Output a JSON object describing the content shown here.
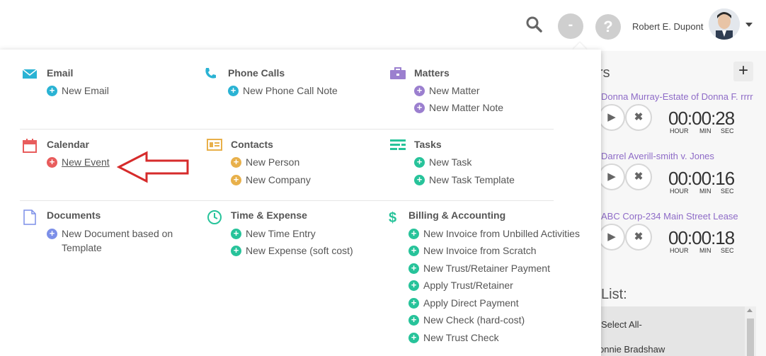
{
  "header": {
    "user_name": "Robert E. Dupont",
    "minus_icon": "-",
    "help_icon": "?"
  },
  "menu": {
    "sections": [
      {
        "title": "Email",
        "icon": "envelope-icon",
        "items": [
          {
            "label": "New Email"
          }
        ]
      },
      {
        "title": "Phone Calls",
        "icon": "phone-icon",
        "items": [
          {
            "label": "New Phone Call Note"
          }
        ]
      },
      {
        "title": "Matters",
        "icon": "briefcase-icon",
        "items": [
          {
            "label": "New Matter"
          },
          {
            "label": "New Matter Note"
          }
        ]
      },
      {
        "title": "Calendar",
        "icon": "calendar-icon",
        "items": [
          {
            "label": "New Event"
          }
        ]
      },
      {
        "title": "Contacts",
        "icon": "contact-card-icon",
        "items": [
          {
            "label": "New Person"
          },
          {
            "label": "New Company"
          }
        ]
      },
      {
        "title": "Tasks",
        "icon": "task-list-icon",
        "items": [
          {
            "label": "New Task"
          },
          {
            "label": "New Task Template"
          }
        ]
      },
      {
        "title": "Documents",
        "icon": "document-icon",
        "items": [
          {
            "label_line1": "New Document based on",
            "label_line2": "Template"
          }
        ]
      },
      {
        "title": "Time & Expense",
        "icon": "clock-icon",
        "items": [
          {
            "label": "New Time Entry"
          },
          {
            "label": "New Expense (soft cost)"
          }
        ]
      },
      {
        "title": "Billing & Accounting",
        "icon": "dollar-icon",
        "items": [
          {
            "label": "New Invoice from Unbilled Activities"
          },
          {
            "label": "New Invoice from Scratch"
          },
          {
            "label": "New Trust/Retainer Payment"
          },
          {
            "label": "Apply Trust/Retainer"
          },
          {
            "label": "Apply Direct Payment"
          },
          {
            "label": "New Check (hard-cost)"
          },
          {
            "label": "New Trust Check"
          }
        ]
      }
    ],
    "plus_glyph": "+"
  },
  "timers": {
    "title_fragment": "rs",
    "add_glyph": "+",
    "play_glyph": "▶",
    "stop_glyph": "✖",
    "units": {
      "hour": "HOUR",
      "min": "MIN",
      "sec": "SEC"
    },
    "entries": [
      {
        "name": "Donna Murray-Estate of Donna F. rrrr",
        "time": "00:00:28"
      },
      {
        "name": "Darrel Averill-smith v. Jones",
        "time": "00:00:16"
      },
      {
        "name": "ABC Corp-234 Main Street Lease",
        "time": "00:00:18"
      }
    ]
  },
  "list": {
    "title_fragment": "List:",
    "items": [
      "Select All-",
      "onnie Bradshaw"
    ]
  },
  "colors": {
    "email": "#2ab3d4",
    "phone": "#2ab3d4",
    "matters": "#9b7fcf",
    "calendar": "#e85c5c",
    "contacts": "#e8b04a",
    "tasks": "#27c39a",
    "documents": "#7c8fe8",
    "time": "#27c39a",
    "billing": "#27c39a",
    "arrow": "#d62b2b"
  }
}
